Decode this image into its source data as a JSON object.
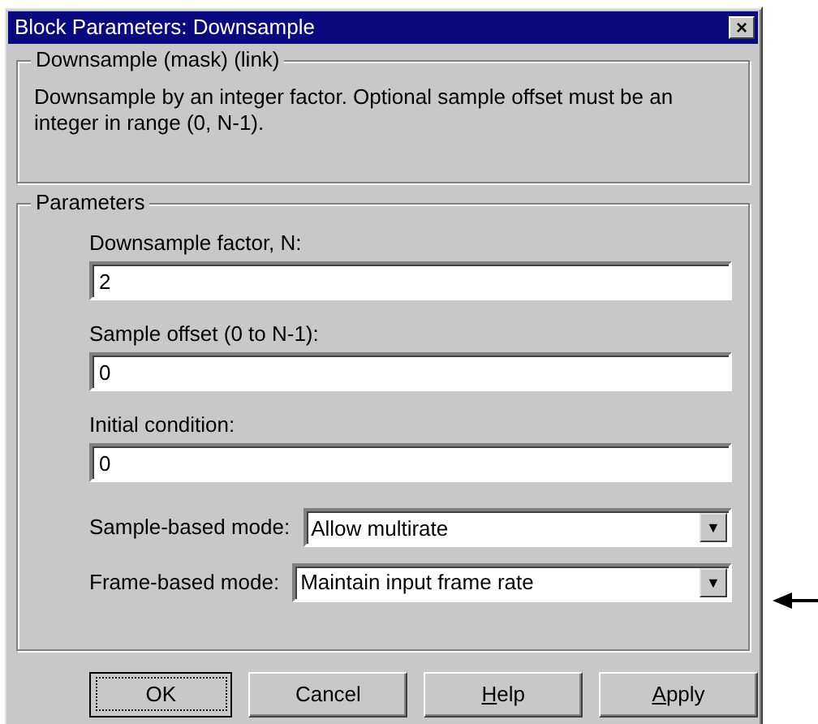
{
  "window": {
    "title": "Block Parameters: Downsample",
    "close": "×"
  },
  "description": {
    "legend": "Downsample (mask) (link)",
    "text": "Downsample by an integer  factor.  Optional sample offset must be an integer in range (0, N-1)."
  },
  "parameters": {
    "legend": "Parameters",
    "fields": [
      {
        "kind": "text",
        "label": "Downsample factor, N:",
        "value": "2"
      },
      {
        "kind": "text",
        "label": "Sample offset (0 to N-1):",
        "value": "0"
      },
      {
        "kind": "text",
        "label": "Initial condition:",
        "value": "0"
      },
      {
        "kind": "select",
        "label": "Sample-based mode:",
        "value": "Allow multirate",
        "arrow": "▼"
      },
      {
        "kind": "select",
        "label": "Frame-based mode:",
        "value": "Maintain input frame rate",
        "arrow": "▼"
      }
    ]
  },
  "buttons": [
    {
      "label": "OK",
      "default": true,
      "underline_first": false
    },
    {
      "label": "Cancel",
      "default": false,
      "underline_first": false
    },
    {
      "label": "Help",
      "default": false,
      "underline_first": true
    },
    {
      "label": "Apply",
      "default": false,
      "underline_first": true
    }
  ]
}
